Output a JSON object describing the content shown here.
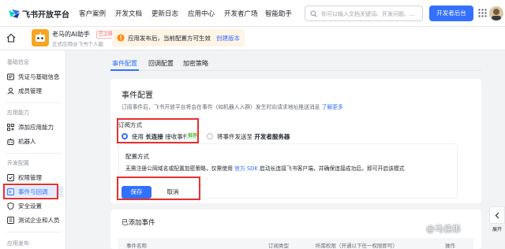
{
  "topnav": {
    "logo_text": "飞书开放平台",
    "items": [
      "客户案例",
      "开发文档",
      "更新日志",
      "应用中心",
      "开发者广场",
      "智能助手"
    ],
    "search_placeholder": "你可以输入文档关键词、开发问题、…",
    "console_button": "开发者后台"
  },
  "app": {
    "name": "老马的AI助手",
    "badge": "已上线",
    "subtitle": "正式应用@飞书个人版",
    "notice_text": "应用发布后，当前配置方可生效",
    "notice_link": "创建版本"
  },
  "sidebar": {
    "groups": [
      {
        "label": "基础信息",
        "items": [
          "凭证与基础信息",
          "成员管理"
        ]
      },
      {
        "label": "应用能力",
        "items": [
          "添加应用能力",
          "机器人"
        ]
      },
      {
        "label": "开发配置",
        "items": [
          "权限管理",
          "事件与回调",
          "安全设置",
          "测试企业和人员"
        ]
      },
      {
        "label": "应用发布",
        "items": []
      }
    ],
    "active_item": "事件与回调"
  },
  "tabs": [
    "事件配置",
    "回调配置",
    "加密策略"
  ],
  "event_config": {
    "title": "事件配置",
    "description": "订阅事件后，飞书开放平台将会在事件（如机器人入群）发生时向请求地址推送消息",
    "description_link": "了解更多",
    "subscription_label": "订阅方式",
    "option1_prefix": "使用",
    "option1_bold": "长连接",
    "option1_suffix": "接收事件",
    "option1_badge": "推荐",
    "option2_prefix": "将事件发送至",
    "option2_bold": "开发者服务器",
    "config_title": "配置方式",
    "config_desc_prefix": "无需注册公网域名或配置加密策略，仅需使用",
    "config_desc_link": "官方 SDK",
    "config_desc_suffix": "启动长连接飞书客户端，并确保连接成功后，即可开启该模式",
    "save_label": "保存",
    "cancel_label": "取消"
  },
  "added_events": {
    "title": "已添加事件",
    "columns": [
      "事件名称",
      "订阅类型",
      "所需权限（开通以下任一权限即可）",
      "操作"
    ]
  },
  "overlay": {
    "expand_label": "展开",
    "watermark": "@马佳彬"
  },
  "colors": {
    "accent": "#3370ff",
    "highlight_border": "#e8312d",
    "notice_bg": "#fff4e6"
  }
}
